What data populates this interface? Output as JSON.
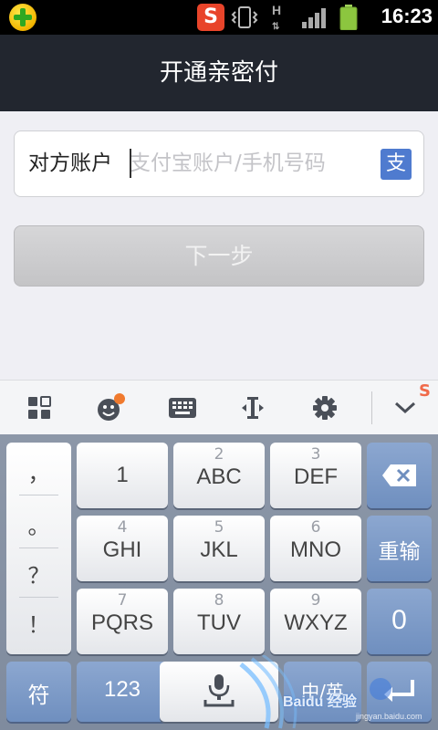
{
  "status_bar": {
    "time": "16:23",
    "network_type": "H",
    "sogou_badge": "S",
    "icons": [
      "app-plus-icon",
      "sogou-input-icon",
      "vibrate-icon",
      "network-h-icon",
      "signal-icon",
      "battery-icon"
    ]
  },
  "header": {
    "title": "开通亲密付"
  },
  "form": {
    "account_label": "对方账户",
    "account_placeholder": "支付宝账户/手机号码",
    "account_value": "",
    "contact_icon_glyph": "支",
    "next_label": "下一步"
  },
  "keyboard": {
    "toolbar": [
      "grid-menu-icon",
      "emoji-icon",
      "keyboard-icon",
      "cursor-move-icon",
      "settings-icon",
      "collapse-icon"
    ],
    "punctuation": [
      "，",
      "。",
      "？",
      "！"
    ],
    "rows": [
      [
        {
          "sub": "",
          "main": "1"
        },
        {
          "sub": "2",
          "main": "ABC"
        },
        {
          "sub": "3",
          "main": "DEF"
        }
      ],
      [
        {
          "sub": "4",
          "main": "GHI"
        },
        {
          "sub": "5",
          "main": "JKL"
        },
        {
          "sub": "6",
          "main": "MNO"
        }
      ],
      [
        {
          "sub": "7",
          "main": "PQRS"
        },
        {
          "sub": "8",
          "main": "TUV"
        },
        {
          "sub": "9",
          "main": "WXYZ"
        }
      ]
    ],
    "reenter_label": "重输",
    "zero_label": "0",
    "symbols_label": "符",
    "numbers_label": "123",
    "lang_label": "中/英",
    "accent_color": "#6f8fbf"
  },
  "watermark": {
    "text": "Baidu 经验",
    "url": "jingyan.baidu.com"
  }
}
